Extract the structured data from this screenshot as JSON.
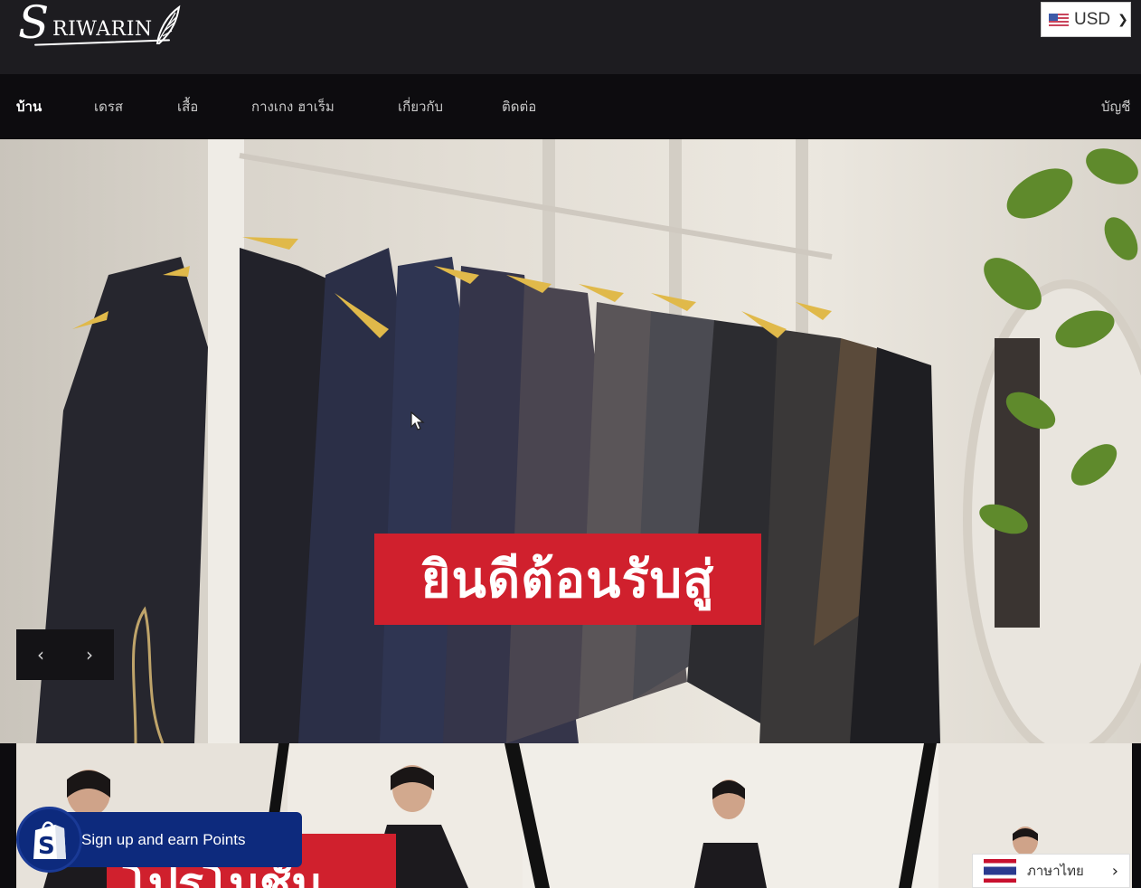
{
  "brand": {
    "logo_cap": "S",
    "logo_rest": "RIWARIN"
  },
  "currency": {
    "code": "USD",
    "flag_icon": "us-flag-icon"
  },
  "nav": {
    "items": [
      {
        "label": "บ้าน",
        "active": true
      },
      {
        "label": "เดรส",
        "active": false
      },
      {
        "label": "เสื้อ",
        "active": false
      },
      {
        "label": "กางเกง ฮาเร็ม",
        "active": false
      },
      {
        "label": "เกี่ยวกับ",
        "active": false
      },
      {
        "label": "ติดต่อ",
        "active": false
      }
    ],
    "account_label": "บัญชี",
    "active_color": "#e03a3e"
  },
  "hero": {
    "banner_text": "ยินดีต้อนรับสู่",
    "banner_color": "#d0202d",
    "prev_icon": "chevron-left-icon",
    "next_icon": "chevron-right-icon"
  },
  "promo": {
    "label_text": "โปรโมชั่น"
  },
  "points_widget": {
    "label": "Sign up and earn Points",
    "color": "#0d2a7d"
  },
  "language": {
    "label": "ภาษาไทย",
    "flag_icon": "thai-flag-icon"
  }
}
